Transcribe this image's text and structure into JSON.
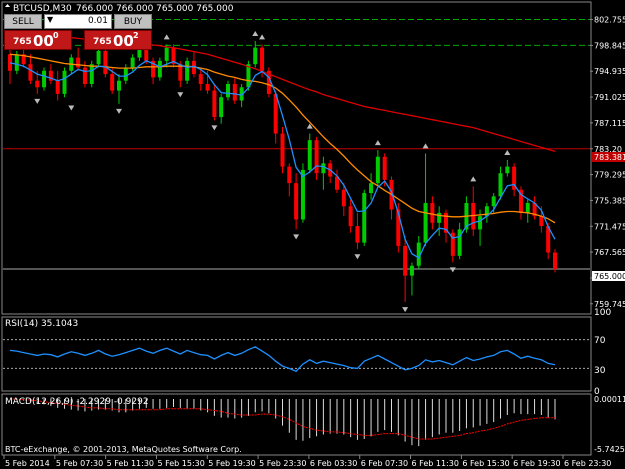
{
  "header": {
    "title": "BTCUSD,M30",
    "ohlc": "766.000 766.000 765.000 765.000"
  },
  "trade_panel": {
    "sell_label": "SELL",
    "buy_label": "BUY",
    "lot_value": "0.01",
    "sell_price_small": "765",
    "sell_price_big": "00",
    "sell_price_sup": "0",
    "buy_price_small": "765",
    "buy_price_big": "00",
    "buy_price_sup": "2"
  },
  "colors": {
    "bull": "#00cc00",
    "bear": "#ff0000",
    "ma_fast": "#1e90ff",
    "ma_mid": "#ff8c00",
    "ma_slow": "#dd0000",
    "rsi": "#1e90ff",
    "macd_signal": "#ff0000",
    "grid_dash": "#00aa00",
    "price_line": "#c00000"
  },
  "price_axis": {
    "ticks": [
      "802.755",
      "798.845",
      "794.935",
      "791.025",
      "787.115",
      "783.20",
      "779.295",
      "775.385",
      "771.475",
      "767.565",
      "763.655",
      "759.745"
    ],
    "ymin": 758.5,
    "ymax": 804.5,
    "red_line_value": 783.2,
    "current_price_label": "765.000",
    "red_line_label": "783.381"
  },
  "rsi_panel": {
    "title": "RSI(14) 35.1043",
    "ticks": [
      "100",
      "70",
      "30",
      "0"
    ]
  },
  "macd_panel": {
    "title": "MACD(12,26,9) -2.2929 -0.9292",
    "ticks": [
      "0.00011",
      "-5.7425"
    ]
  },
  "copyright": "BTC-eExchange, © 2001-2013, MetaQuotes Software Corp.",
  "time_axis": [
    "5 Feb 2014",
    "5 Feb 07:30",
    "5 Feb 11:30",
    "5 Feb 15:30",
    "5 Feb 19:30",
    "5 Feb 23:30",
    "6 Feb 03:30",
    "6 Feb 07:30",
    "6 Feb 11:30",
    "6 Feb 15:30",
    "6 Feb 19:30",
    "6 Feb 23:30"
  ],
  "chart_data": {
    "type": "candlestick",
    "title": "BTCUSD,M30",
    "ylim": [
      758.5,
      804.5
    ],
    "candles": [
      {
        "o": 797.5,
        "h": 799.5,
        "l": 793.0,
        "c": 795.0
      },
      {
        "o": 795.0,
        "h": 798.0,
        "l": 794.5,
        "c": 797.5
      },
      {
        "o": 797.5,
        "h": 798.5,
        "l": 795.5,
        "c": 796.0
      },
      {
        "o": 796.0,
        "h": 797.5,
        "l": 793.0,
        "c": 793.5
      },
      {
        "o": 793.5,
        "h": 795.0,
        "l": 791.5,
        "c": 792.5
      },
      {
        "o": 792.5,
        "h": 795.5,
        "l": 792.0,
        "c": 795.0
      },
      {
        "o": 795.0,
        "h": 796.0,
        "l": 793.0,
        "c": 793.5
      },
      {
        "o": 793.5,
        "h": 795.0,
        "l": 790.5,
        "c": 791.5
      },
      {
        "o": 791.5,
        "h": 795.5,
        "l": 791.0,
        "c": 795.0
      },
      {
        "o": 795.0,
        "h": 797.5,
        "l": 794.5,
        "c": 797.0
      },
      {
        "o": 797.0,
        "h": 798.5,
        "l": 795.0,
        "c": 795.5
      },
      {
        "o": 795.5,
        "h": 796.5,
        "l": 792.5,
        "c": 793.0
      },
      {
        "o": 793.0,
        "h": 796.5,
        "l": 792.5,
        "c": 796.0
      },
      {
        "o": 796.0,
        "h": 799.0,
        "l": 795.5,
        "c": 798.0
      },
      {
        "o": 798.0,
        "h": 798.5,
        "l": 794.0,
        "c": 794.5
      },
      {
        "o": 794.5,
        "h": 795.5,
        "l": 791.5,
        "c": 792.0
      },
      {
        "o": 792.0,
        "h": 794.5,
        "l": 790.0,
        "c": 793.5
      },
      {
        "o": 793.5,
        "h": 796.0,
        "l": 793.0,
        "c": 795.5
      },
      {
        "o": 795.5,
        "h": 797.5,
        "l": 795.0,
        "c": 797.0
      },
      {
        "o": 797.0,
        "h": 799.5,
        "l": 796.5,
        "c": 799.0
      },
      {
        "o": 799.0,
        "h": 799.5,
        "l": 796.0,
        "c": 796.5
      },
      {
        "o": 796.5,
        "h": 797.0,
        "l": 793.0,
        "c": 794.0
      },
      {
        "o": 794.0,
        "h": 797.0,
        "l": 793.5,
        "c": 796.5
      },
      {
        "o": 796.5,
        "h": 799.0,
        "l": 795.5,
        "c": 798.5
      },
      {
        "o": 798.5,
        "h": 799.0,
        "l": 795.5,
        "c": 796.0
      },
      {
        "o": 796.0,
        "h": 796.5,
        "l": 792.5,
        "c": 793.5
      },
      {
        "o": 793.5,
        "h": 797.0,
        "l": 793.0,
        "c": 796.5
      },
      {
        "o": 796.5,
        "h": 798.0,
        "l": 794.0,
        "c": 794.5
      },
      {
        "o": 794.5,
        "h": 795.5,
        "l": 792.0,
        "c": 793.0
      },
      {
        "o": 793.0,
        "h": 795.0,
        "l": 791.5,
        "c": 792.0
      },
      {
        "o": 792.0,
        "h": 793.0,
        "l": 787.5,
        "c": 788.0
      },
      {
        "o": 788.0,
        "h": 791.5,
        "l": 787.0,
        "c": 791.0
      },
      {
        "o": 791.0,
        "h": 793.5,
        "l": 790.5,
        "c": 793.0
      },
      {
        "o": 793.0,
        "h": 794.0,
        "l": 790.0,
        "c": 790.5
      },
      {
        "o": 790.5,
        "h": 793.0,
        "l": 789.5,
        "c": 792.5
      },
      {
        "o": 792.5,
        "h": 796.5,
        "l": 792.0,
        "c": 796.0
      },
      {
        "o": 796.0,
        "h": 799.5,
        "l": 795.5,
        "c": 798.5
      },
      {
        "o": 798.5,
        "h": 799.0,
        "l": 794.0,
        "c": 795.0
      },
      {
        "o": 795.0,
        "h": 795.5,
        "l": 791.0,
        "c": 791.5
      },
      {
        "o": 791.5,
        "h": 792.0,
        "l": 784.0,
        "c": 785.5
      },
      {
        "o": 785.5,
        "h": 786.5,
        "l": 779.5,
        "c": 780.5
      },
      {
        "o": 780.5,
        "h": 781.0,
        "l": 776.0,
        "c": 778.0
      },
      {
        "o": 778.0,
        "h": 779.5,
        "l": 771.0,
        "c": 772.5
      },
      {
        "o": 772.5,
        "h": 781.0,
        "l": 772.0,
        "c": 780.0
      },
      {
        "o": 780.0,
        "h": 785.5,
        "l": 779.5,
        "c": 784.5
      },
      {
        "o": 784.5,
        "h": 785.0,
        "l": 778.5,
        "c": 779.5
      },
      {
        "o": 779.5,
        "h": 782.0,
        "l": 777.0,
        "c": 781.0
      },
      {
        "o": 781.0,
        "h": 781.5,
        "l": 778.0,
        "c": 779.0
      },
      {
        "o": 779.0,
        "h": 780.0,
        "l": 776.5,
        "c": 777.0
      },
      {
        "o": 777.0,
        "h": 778.0,
        "l": 773.0,
        "c": 774.5
      },
      {
        "o": 774.5,
        "h": 775.5,
        "l": 770.5,
        "c": 771.5
      },
      {
        "o": 771.5,
        "h": 773.5,
        "l": 768.0,
        "c": 769.0
      },
      {
        "o": 769.0,
        "h": 777.0,
        "l": 768.5,
        "c": 776.5
      },
      {
        "o": 776.5,
        "h": 779.5,
        "l": 775.5,
        "c": 778.0
      },
      {
        "o": 778.0,
        "h": 783.0,
        "l": 777.5,
        "c": 782.0
      },
      {
        "o": 782.0,
        "h": 782.5,
        "l": 777.5,
        "c": 778.5
      },
      {
        "o": 778.5,
        "h": 779.0,
        "l": 772.5,
        "c": 774.0
      },
      {
        "o": 774.0,
        "h": 775.0,
        "l": 767.5,
        "c": 768.5
      },
      {
        "o": 768.5,
        "h": 770.0,
        "l": 760.0,
        "c": 764.0
      },
      {
        "o": 764.0,
        "h": 766.0,
        "l": 761.0,
        "c": 765.5
      },
      {
        "o": 765.5,
        "h": 770.0,
        "l": 765.0,
        "c": 769.0
      },
      {
        "o": 769.0,
        "h": 782.5,
        "l": 768.5,
        "c": 775.0
      },
      {
        "o": 775.0,
        "h": 776.0,
        "l": 771.0,
        "c": 772.0
      },
      {
        "o": 772.0,
        "h": 774.5,
        "l": 770.0,
        "c": 773.5
      },
      {
        "o": 773.5,
        "h": 774.0,
        "l": 769.0,
        "c": 770.5
      },
      {
        "o": 770.5,
        "h": 771.0,
        "l": 766.0,
        "c": 767.0
      },
      {
        "o": 767.0,
        "h": 772.0,
        "l": 766.5,
        "c": 771.0
      },
      {
        "o": 771.0,
        "h": 776.0,
        "l": 770.5,
        "c": 775.0
      },
      {
        "o": 775.0,
        "h": 777.5,
        "l": 770.0,
        "c": 771.0
      },
      {
        "o": 771.0,
        "h": 774.0,
        "l": 768.5,
        "c": 773.0
      },
      {
        "o": 773.0,
        "h": 775.0,
        "l": 772.0,
        "c": 774.5
      },
      {
        "o": 774.5,
        "h": 776.5,
        "l": 773.5,
        "c": 776.0
      },
      {
        "o": 776.0,
        "h": 780.5,
        "l": 775.5,
        "c": 779.5
      },
      {
        "o": 779.5,
        "h": 781.5,
        "l": 779.0,
        "c": 780.5
      },
      {
        "o": 780.5,
        "h": 781.0,
        "l": 776.0,
        "c": 777.0
      },
      {
        "o": 777.0,
        "h": 777.5,
        "l": 772.5,
        "c": 773.5
      },
      {
        "o": 773.5,
        "h": 775.5,
        "l": 772.0,
        "c": 775.0
      },
      {
        "o": 775.0,
        "h": 776.0,
        "l": 772.5,
        "c": 773.0
      },
      {
        "o": 773.0,
        "h": 774.5,
        "l": 770.5,
        "c": 771.5
      },
      {
        "o": 771.5,
        "h": 772.0,
        "l": 766.5,
        "c": 767.5
      },
      {
        "o": 767.5,
        "h": 768.0,
        "l": 764.5,
        "c": 765.0
      }
    ],
    "ma_fast": [
      796.2,
      796.0,
      795.7,
      795.1,
      794.5,
      794.2,
      793.9,
      793.5,
      793.8,
      794.5,
      795.2,
      794.9,
      795.0,
      795.7,
      795.6,
      794.9,
      794.2,
      794.2,
      794.8,
      795.8,
      796.5,
      796.1,
      795.6,
      796.0,
      796.4,
      795.9,
      795.5,
      795.7,
      795.2,
      794.4,
      792.9,
      791.7,
      791.6,
      791.5,
      791.3,
      792.4,
      794.3,
      794.9,
      794.0,
      791.6,
      788.2,
      784.6,
      780.4,
      779.0,
      779.7,
      780.6,
      780.5,
      780.0,
      779.1,
      777.7,
      775.7,
      773.7,
      773.8,
      775.0,
      777.4,
      778.3,
      776.7,
      773.5,
      769.5,
      767.3,
      766.7,
      768.9,
      770.1,
      771.2,
      771.0,
      769.7,
      769.9,
      771.5,
      772.0,
      772.3,
      773.0,
      774.0,
      775.8,
      777.6,
      777.8,
      776.3,
      775.6,
      775.0,
      773.9,
      771.4,
      769.5
    ],
    "ma_mid": [
      797.5,
      797.4,
      797.3,
      797.1,
      796.9,
      796.7,
      796.5,
      796.3,
      796.1,
      796.0,
      795.9,
      795.8,
      795.7,
      795.7,
      795.6,
      795.5,
      795.4,
      795.4,
      795.4,
      795.5,
      795.6,
      795.6,
      795.6,
      795.7,
      795.7,
      795.7,
      795.7,
      795.6,
      795.4,
      795.2,
      794.8,
      794.5,
      794.2,
      794.0,
      793.7,
      793.5,
      793.4,
      793.2,
      792.9,
      792.4,
      791.6,
      790.6,
      789.5,
      788.3,
      787.2,
      786.1,
      785.0,
      784.0,
      783.1,
      782.1,
      781.0,
      780.0,
      779.1,
      778.2,
      777.6,
      776.9,
      776.3,
      775.6,
      774.9,
      774.2,
      773.7,
      773.5,
      773.3,
      773.1,
      773.0,
      772.9,
      772.9,
      773.0,
      773.1,
      773.2,
      773.3,
      773.4,
      773.6,
      773.7,
      773.7,
      773.6,
      773.5,
      773.3,
      773.0,
      772.6,
      772.0
    ],
    "ma_slow": [
      800.8,
      800.7,
      800.6,
      800.5,
      800.4,
      800.3,
      800.2,
      800.2,
      800.1,
      800.0,
      799.9,
      799.8,
      799.7,
      799.6,
      799.6,
      799.5,
      799.4,
      799.3,
      799.2,
      799.1,
      799.0,
      798.9,
      798.8,
      798.6,
      798.5,
      798.3,
      798.1,
      797.9,
      797.7,
      797.5,
      797.2,
      796.9,
      796.6,
      796.3,
      796.0,
      795.6,
      795.3,
      794.9,
      794.5,
      794.1,
      793.7,
      793.3,
      792.9,
      792.5,
      792.1,
      791.8,
      791.4,
      791.1,
      790.8,
      790.5,
      790.2,
      789.9,
      789.6,
      789.4,
      789.2,
      789.0,
      788.8,
      788.6,
      788.4,
      788.2,
      788.0,
      787.8,
      787.6,
      787.4,
      787.2,
      787.0,
      786.8,
      786.6,
      786.4,
      786.1,
      785.8,
      785.5,
      785.2,
      784.9,
      784.6,
      784.3,
      784.0,
      783.7,
      783.4,
      783.1,
      782.8
    ],
    "fractals": [
      {
        "i": 1,
        "type": "up",
        "v": 798.0
      },
      {
        "i": 4,
        "type": "down",
        "v": 791.5
      },
      {
        "i": 9,
        "type": "down",
        "v": 790.5
      },
      {
        "i": 13,
        "type": "up",
        "v": 799.0
      },
      {
        "i": 16,
        "type": "down",
        "v": 790.0
      },
      {
        "i": 19,
        "type": "up",
        "v": 799.5
      },
      {
        "i": 23,
        "type": "up",
        "v": 799.0
      },
      {
        "i": 25,
        "type": "down",
        "v": 792.5
      },
      {
        "i": 30,
        "type": "down",
        "v": 787.5
      },
      {
        "i": 36,
        "type": "up",
        "v": 799.5
      },
      {
        "i": 37,
        "type": "up",
        "v": 799.0
      },
      {
        "i": 42,
        "type": "down",
        "v": 771.0
      },
      {
        "i": 44,
        "type": "up",
        "v": 785.5
      },
      {
        "i": 51,
        "type": "down",
        "v": 768.0
      },
      {
        "i": 54,
        "type": "up",
        "v": 783.0
      },
      {
        "i": 58,
        "type": "down",
        "v": 760.0
      },
      {
        "i": 61,
        "type": "up",
        "v": 782.5
      },
      {
        "i": 65,
        "type": "down",
        "v": 766.0
      },
      {
        "i": 68,
        "type": "up",
        "v": 777.5
      },
      {
        "i": 73,
        "type": "up",
        "v": 781.5
      }
    ],
    "rsi": [
      55,
      54,
      52,
      50,
      48,
      50,
      49,
      46,
      50,
      53,
      51,
      48,
      51,
      55,
      50,
      47,
      49,
      52,
      55,
      58,
      54,
      51,
      55,
      58,
      54,
      50,
      55,
      52,
      49,
      48,
      43,
      48,
      52,
      48,
      51,
      56,
      60,
      54,
      48,
      40,
      33,
      30,
      26,
      36,
      42,
      37,
      40,
      38,
      36,
      34,
      31,
      30,
      40,
      44,
      48,
      43,
      38,
      33,
      28,
      30,
      34,
      42,
      39,
      41,
      38,
      35,
      40,
      45,
      41,
      43,
      46,
      48,
      53,
      55,
      50,
      44,
      47,
      44,
      42,
      37,
      35
    ],
    "rsi_range": [
      0,
      100
    ],
    "macd_hist": [
      0.0,
      -0.1,
      -0.2,
      -0.3,
      -0.5,
      -0.6,
      -0.8,
      -1.0,
      -1.1,
      -1.2,
      -1.3,
      -1.4,
      -1.3,
      -1.2,
      -1.2,
      -1.3,
      -1.5,
      -1.5,
      -1.3,
      -1.1,
      -1.0,
      -1.1,
      -1.1,
      -1.0,
      -0.9,
      -1.0,
      -1.1,
      -1.1,
      -1.3,
      -1.5,
      -1.9,
      -2.1,
      -2.1,
      -2.2,
      -2.1,
      -1.9,
      -1.5,
      -1.4,
      -1.6,
      -2.2,
      -3.0,
      -3.8,
      -4.6,
      -4.7,
      -4.4,
      -4.2,
      -4.0,
      -3.9,
      -3.9,
      -4.0,
      -4.3,
      -4.6,
      -4.5,
      -4.2,
      -3.7,
      -3.5,
      -3.7,
      -4.1,
      -4.8,
      -5.2,
      -5.3,
      -4.6,
      -4.3,
      -4.0,
      -3.8,
      -3.8,
      -3.6,
      -3.3,
      -3.2,
      -3.0,
      -2.8,
      -2.6,
      -2.2,
      -1.8,
      -1.6,
      -1.7,
      -1.7,
      -1.7,
      -1.8,
      -2.1,
      -2.3
    ],
    "macd_signal": [
      0.0,
      0.0,
      -0.1,
      -0.1,
      -0.2,
      -0.3,
      -0.4,
      -0.5,
      -0.6,
      -0.7,
      -0.8,
      -0.9,
      -1.0,
      -1.0,
      -1.1,
      -1.1,
      -1.2,
      -1.2,
      -1.2,
      -1.2,
      -1.2,
      -1.2,
      -1.2,
      -1.1,
      -1.1,
      -1.1,
      -1.1,
      -1.1,
      -1.1,
      -1.2,
      -1.3,
      -1.4,
      -1.6,
      -1.7,
      -1.8,
      -1.8,
      -1.8,
      -1.7,
      -1.7,
      -1.8,
      -2.0,
      -2.3,
      -2.7,
      -3.1,
      -3.3,
      -3.5,
      -3.6,
      -3.7,
      -3.7,
      -3.8,
      -3.9,
      -4.0,
      -4.1,
      -4.1,
      -4.0,
      -3.9,
      -3.9,
      -3.9,
      -4.1,
      -4.3,
      -4.5,
      -4.5,
      -4.5,
      -4.4,
      -4.3,
      -4.2,
      -4.1,
      -3.9,
      -3.8,
      -3.6,
      -3.5,
      -3.3,
      -3.1,
      -2.8,
      -2.6,
      -2.4,
      -2.3,
      -2.2,
      -2.1,
      -2.1,
      -2.1
    ],
    "macd_range": [
      -5.7425,
      0.00011
    ]
  }
}
